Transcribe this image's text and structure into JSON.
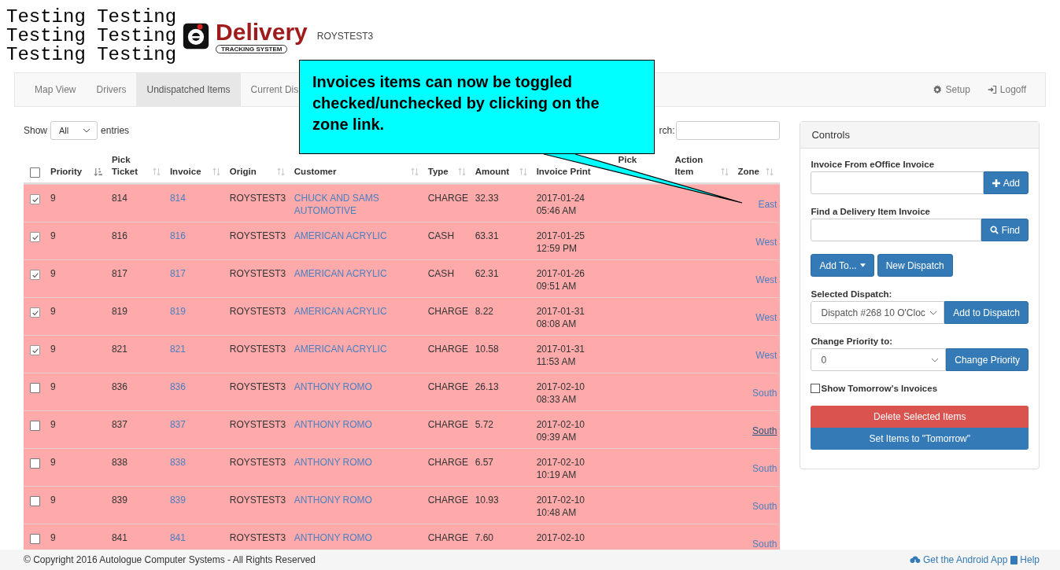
{
  "header": {
    "overlay_lines": [
      "Testing Testing",
      "Testing Testing",
      "Testing Testing"
    ],
    "logo_word": "Delivery",
    "logo_tagline": "TRACKING SYSTEM",
    "account": "ROYSTEST3"
  },
  "nav": {
    "tabs": [
      {
        "label": "Map View",
        "selected": false
      },
      {
        "label": "Drivers",
        "selected": false
      },
      {
        "label": "Undispatched Items",
        "selected": true
      },
      {
        "label": "Current Dis",
        "selected": false
      }
    ],
    "right_links": [
      {
        "kind": "setup",
        "label": "Setup"
      },
      {
        "kind": "logoff",
        "label": "Logoff"
      }
    ]
  },
  "table_controls": {
    "show_label": "Show",
    "page_size": "All",
    "entries_label": "entries",
    "search_label": "rch:"
  },
  "table": {
    "select_all_checked": false,
    "columns": [
      {
        "label": "Priority",
        "sorted": true
      },
      {
        "label": "Pick Ticket",
        "sorted": false,
        "sortable": true
      },
      {
        "label": "Invoice",
        "sorted": false,
        "sortable": true
      },
      {
        "label": "Origin",
        "sorted": false,
        "sortable": true
      },
      {
        "label": "Customer",
        "sorted": false,
        "sortable": true
      },
      {
        "label": "Type",
        "sorted": false,
        "sortable": true
      },
      {
        "label": "Amount",
        "sorted": false,
        "sortable": true
      },
      {
        "label": "Invoice Print",
        "sorted": false,
        "sortable": false
      },
      {
        "label": "Pick",
        "sorted": false,
        "sortable": false
      },
      {
        "label": "Action Item",
        "sorted": false,
        "sortable": true
      },
      {
        "label": "Zone",
        "sorted": false,
        "sortable": true
      }
    ],
    "rows": [
      {
        "checked": true,
        "priority": "9",
        "pick_ticket": "814",
        "invoice": "814",
        "origin": "ROYSTEST3",
        "customer": "CHUCK AND SAMS AUTOMOTIVE",
        "type": "CHARGE",
        "amount": "32.33",
        "print_date": "2017-01-24",
        "print_time": "05:46 AM",
        "zone": "East",
        "hovered": false
      },
      {
        "checked": true,
        "priority": "9",
        "pick_ticket": "816",
        "invoice": "816",
        "origin": "ROYSTEST3",
        "customer": "AMERICAN ACRYLIC",
        "type": "CASH",
        "amount": "63.31",
        "print_date": "2017-01-25",
        "print_time": "12:59 PM",
        "zone": "West",
        "hovered": false
      },
      {
        "checked": true,
        "priority": "9",
        "pick_ticket": "817",
        "invoice": "817",
        "origin": "ROYSTEST3",
        "customer": "AMERICAN ACRYLIC",
        "type": "CASH",
        "amount": "62.31",
        "print_date": "2017-01-26",
        "print_time": "09:51 AM",
        "zone": "West",
        "hovered": false
      },
      {
        "checked": true,
        "priority": "9",
        "pick_ticket": "819",
        "invoice": "819",
        "origin": "ROYSTEST3",
        "customer": "AMERICAN ACRYLIC",
        "type": "CHARGE",
        "amount": "8.22",
        "print_date": "2017-01-31",
        "print_time": "08:08 AM",
        "zone": "West",
        "hovered": false
      },
      {
        "checked": true,
        "priority": "9",
        "pick_ticket": "821",
        "invoice": "821",
        "origin": "ROYSTEST3",
        "customer": "AMERICAN ACRYLIC",
        "type": "CHARGE",
        "amount": "10.58",
        "print_date": "2017-01-31",
        "print_time": "11:53 AM",
        "zone": "West",
        "hovered": false
      },
      {
        "checked": false,
        "priority": "9",
        "pick_ticket": "836",
        "invoice": "836",
        "origin": "ROYSTEST3",
        "customer": "ANTHONY ROMO",
        "type": "CHARGE",
        "amount": "26.13",
        "print_date": "2017-02-10",
        "print_time": "08:33 AM",
        "zone": "South",
        "hovered": false
      },
      {
        "checked": false,
        "priority": "9",
        "pick_ticket": "837",
        "invoice": "837",
        "origin": "ROYSTEST3",
        "customer": "ANTHONY ROMO",
        "type": "CHARGE",
        "amount": "5.72",
        "print_date": "2017-02-10",
        "print_time": "09:39 AM",
        "zone": "South",
        "hovered": true
      },
      {
        "checked": false,
        "priority": "9",
        "pick_ticket": "838",
        "invoice": "838",
        "origin": "ROYSTEST3",
        "customer": "ANTHONY ROMO",
        "type": "CHARGE",
        "amount": "6.57",
        "print_date": "2017-02-10",
        "print_time": "10:19 AM",
        "zone": "South",
        "hovered": false
      },
      {
        "checked": false,
        "priority": "9",
        "pick_ticket": "839",
        "invoice": "839",
        "origin": "ROYSTEST3",
        "customer": "ANTHONY ROMO",
        "type": "CHARGE",
        "amount": "10.93",
        "print_date": "2017-02-10",
        "print_time": "10:48 AM",
        "zone": "South",
        "hovered": false
      },
      {
        "checked": false,
        "priority": "9",
        "pick_ticket": "841",
        "invoice": "841",
        "origin": "ROYSTEST3",
        "customer": "ANTHONY ROMO",
        "type": "CHARGE",
        "amount": "7.60",
        "print_date": "2017-02-10",
        "zone": "South",
        "hovered": false
      }
    ]
  },
  "controls": {
    "title": "Controls",
    "invoice_label": "Invoice From eOffice Invoice",
    "add_button": "Add",
    "find_label": "Find a Delivery Item Invoice",
    "find_button": "Find",
    "add_to_button": "Add To...",
    "new_dispatch_button": "New Dispatch",
    "selected_dispatch_label": "Selected Dispatch:",
    "selected_dispatch": "Dispatch #268 10 O'Cloc",
    "add_to_dispatch_button": "Add to Dispatch",
    "priority_label": "Change Priority to:",
    "priority_value": "0",
    "change_priority_button": "Change Priority",
    "show_tomorrow": {
      "label": "Show Tomorrow's Invoices",
      "checked": false
    },
    "delete_button": "Delete Selected Items",
    "tomorrow_button": "Set Items to \"Tomorrow\""
  },
  "callout": {
    "text": "Invoices items can now be toggled checked/unchecked by clicking on the zone link."
  },
  "footer": {
    "copyright": "© Copyright 2016 Autologue Computer Systems - All Rights Reserved",
    "android_link": "Get the Android App",
    "help_link": "Help"
  }
}
